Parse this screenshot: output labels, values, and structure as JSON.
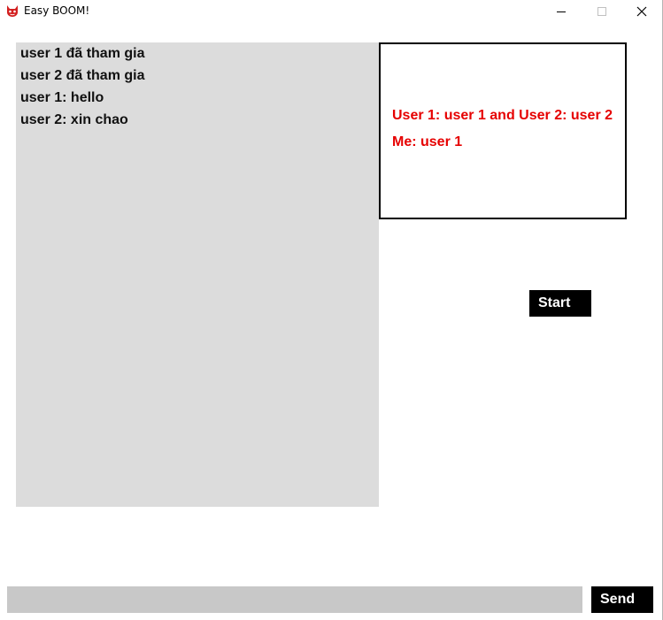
{
  "window": {
    "title": "Easy BOOM!",
    "app_icon": "devil-face-icon",
    "controls": [
      "minimize-icon",
      "maximize-icon",
      "close-icon"
    ]
  },
  "chat": {
    "messages": [
      "user 1 đã tham gia",
      "user 2 đã tham gia",
      "user 1: hello",
      "user 2: xin chao"
    ]
  },
  "info": {
    "players_line": "User 1: user 1 and User 2: user 2",
    "me_line": "Me: user 1",
    "text_color": "#e60000"
  },
  "controls": {
    "start_label": "Start",
    "send_label": "Send",
    "message_value": "",
    "message_placeholder": ""
  },
  "colors": {
    "chat_bg": "#dcdcdc",
    "input_bg": "#c8c8c8",
    "button_bg": "#000000",
    "button_text": "#ffffff"
  }
}
